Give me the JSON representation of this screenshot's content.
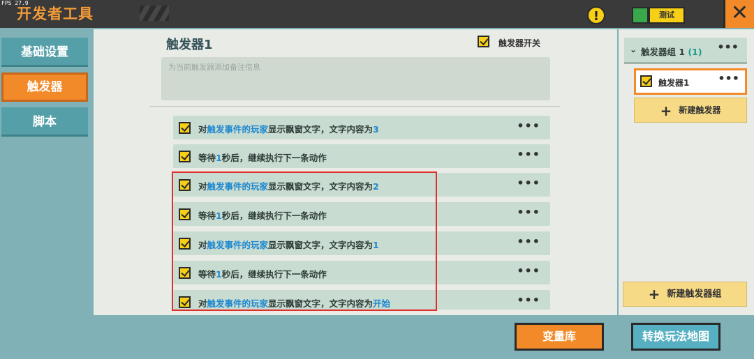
{
  "fps": "FPS 27.9",
  "app_title": "开发者工具",
  "top": {
    "test_label": "测试",
    "warning_icon": "exclamation-icon",
    "close_icon": "close-icon"
  },
  "nav": [
    {
      "label": "基础设置"
    },
    {
      "label": "触发器"
    },
    {
      "label": "脚本"
    }
  ],
  "trigger": {
    "title": "触发器1",
    "switch_label": "触发器开关",
    "note_placeholder": "为当前触发器添加备注信息"
  },
  "actions": [
    {
      "pre": "对",
      "hl": "触发事件的玩家",
      "mid": "显示飘窗文字，文字内容为",
      "val": "3"
    },
    {
      "pre": "等待",
      "hl": "1",
      "mid": "秒后，继续执行下一条动作",
      "val": ""
    },
    {
      "pre": "对",
      "hl": "触发事件的玩家",
      "mid": "显示飘窗文字，文字内容为",
      "val": "2"
    },
    {
      "pre": "等待",
      "hl": "1",
      "mid": "秒后，继续执行下一条动作",
      "val": ""
    },
    {
      "pre": "对",
      "hl": "触发事件的玩家",
      "mid": "显示飘窗文字，文字内容为",
      "val": "1"
    },
    {
      "pre": "等待",
      "hl": "1",
      "mid": "秒后，继续执行下一条动作",
      "val": ""
    },
    {
      "pre": "对",
      "hl": "触发事件的玩家",
      "mid": "显示飘窗文字，文字内容为",
      "val": "开始"
    }
  ],
  "more_glyph": "•••",
  "right": {
    "group_name": "触发器组 1",
    "group_count": "(1)",
    "trigger_name": "触发器1",
    "new_trigger": "新建触发器",
    "new_group": "新建触发器组"
  },
  "bottom": {
    "variables": "变量库",
    "switch_map": "转换玩法地图"
  },
  "colors": {
    "accent_orange": "#f28a29",
    "highlight_blue": "#1e88d0",
    "check_yellow": "#f6cf16",
    "annotation_red": "#e0302b"
  }
}
